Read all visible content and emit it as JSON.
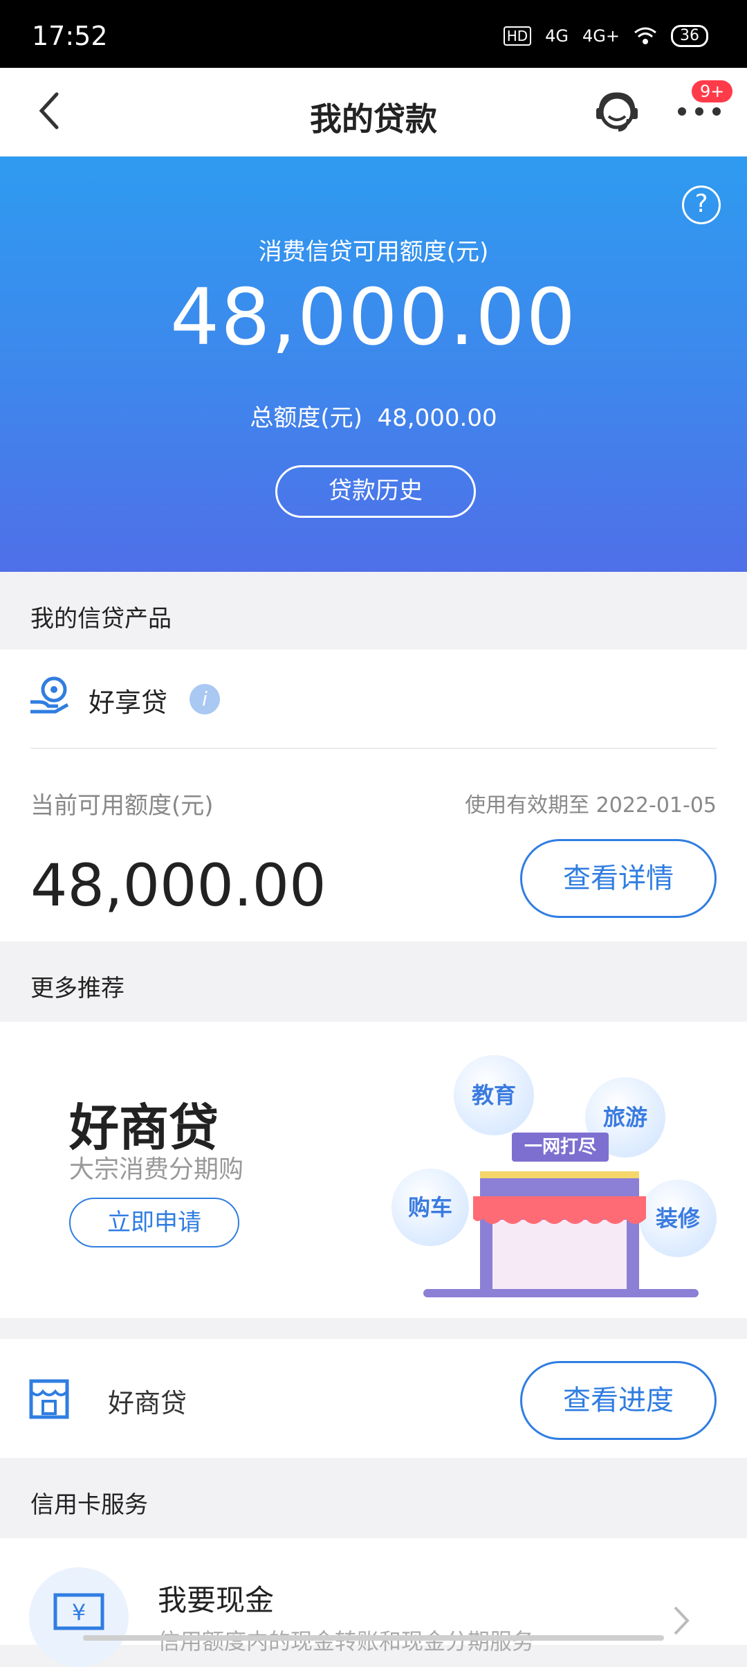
{
  "status_bar": {
    "time": "17:52",
    "network1": "4G",
    "network2": "4G+",
    "battery": "36"
  },
  "nav": {
    "title": "我的贷款",
    "badge": "9+"
  },
  "hero": {
    "subtitle": "消费信贷可用额度(元)",
    "amount": "48,000.00",
    "total_label": "总额度(元)",
    "total_value": "48,000.00",
    "history_button": "贷款历史"
  },
  "products_section": {
    "header": "我的信贷产品",
    "product_name": "好享贷",
    "available_label": "当前可用额度(元)",
    "validity": "使用有效期至 2022-01-05",
    "available_amount": "48,000.00",
    "detail_button": "查看详情"
  },
  "recommend_section": {
    "header": "更多推荐",
    "banner_title": "好商贷",
    "banner_subtitle": "大宗消费分期购",
    "apply_button": "立即申请",
    "bubbles": [
      "教育",
      "旅游",
      "购车",
      "装修"
    ],
    "store_sign": "一网打尽"
  },
  "progress_row": {
    "name": "好商贷",
    "button": "查看进度"
  },
  "credit_section": {
    "header": "信用卡服务",
    "item_title": "我要现金",
    "item_desc": "信用额度内的现金转账和现金分期服务"
  },
  "colors": {
    "accent": "#2f7de1",
    "hero_top": "#2e9bf0",
    "hero_bottom": "#4f6fe8",
    "badge": "#ff3b4a"
  }
}
